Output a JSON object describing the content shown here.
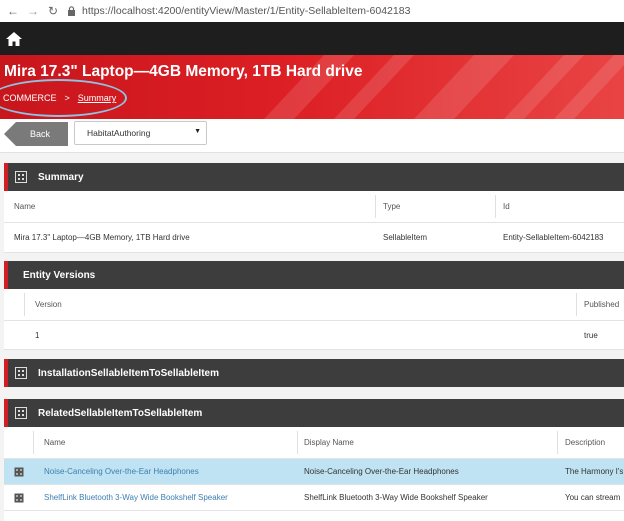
{
  "browser": {
    "url": "https://localhost:4200/entityView/Master/1/Entity-SellableItem-6042183"
  },
  "header": {
    "title": "Mira 17.3\" Laptop—4GB Memory, 1TB Hard drive",
    "breadcrumb": {
      "root": "COMMERCE",
      "separator": ">",
      "current": "Summary"
    }
  },
  "toolbar": {
    "back_label": "Back",
    "environment_selected": "HabitatAuthoring"
  },
  "summary": {
    "title": "Summary",
    "columns": [
      "Name",
      "Type",
      "Id"
    ],
    "row": [
      "Mira 17.3\" Laptop—4GB Memory, 1TB Hard drive",
      "SellableItem",
      "Entity-SellableItem-6042183"
    ]
  },
  "versions": {
    "title": "Entity Versions",
    "columns": [
      "Version",
      "Published"
    ],
    "row": [
      "1",
      "true"
    ]
  },
  "installation": {
    "title": "InstallationSellableItemToSellableItem"
  },
  "related": {
    "title": "RelatedSellableItemToSellableItem",
    "columns": [
      "Name",
      "Display Name",
      "Description"
    ],
    "rows": [
      [
        "Noise-Canceling Over-the-Ear Headphones",
        "Noise-Canceling Over-the-Ear Headphones",
        "The Harmony I's"
      ],
      [
        "ShelfLink Bluetooth 3-Way Wide Bookshelf Speaker",
        "ShelfLink Bluetooth 3-Way Wide Bookshelf Speaker",
        "You can stream"
      ]
    ]
  },
  "colors": {
    "brand_red": "#d11e25",
    "panel_dark": "#3d3d3d",
    "selected_row": "#bfe3f2",
    "link": "#3d7fb0"
  }
}
